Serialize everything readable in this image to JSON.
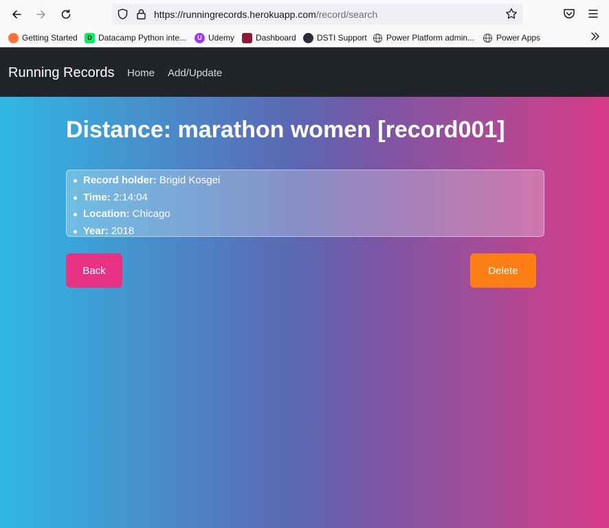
{
  "browser": {
    "url_host": "https://runningrecords.herokuapp.com",
    "url_path": "/record/search",
    "bookmarks": [
      {
        "label": "Getting Started",
        "icon": "firefox-icon",
        "color": "#ff7139"
      },
      {
        "label": "Datacamp Python inte...",
        "icon": "datacamp-icon",
        "color": "#03ef62"
      },
      {
        "label": "Udemy",
        "icon": "udemy-icon",
        "color": "#a435f0"
      },
      {
        "label": "Dashboard",
        "icon": "dashboard-icon",
        "color": "#8b1a3a"
      },
      {
        "label": "DSTI Support",
        "icon": "dsti-icon",
        "color": "#2b2b3a"
      },
      {
        "label": "Power Platform admin...",
        "icon": "globe-icon",
        "color": "#444444"
      },
      {
        "label": "Power Apps",
        "icon": "globe-icon",
        "color": "#444444"
      }
    ]
  },
  "navbar": {
    "brand": "Running Records",
    "links": [
      "Home",
      "Add/Update"
    ]
  },
  "page": {
    "title": "Distance: marathon women [record001]",
    "details": [
      {
        "label": "Record holder:",
        "value": "Brigid Kosgei"
      },
      {
        "label": "Time:",
        "value": "2:14:04"
      },
      {
        "label": "Location:",
        "value": "Chicago"
      },
      {
        "label": "Year:",
        "value": "2018"
      }
    ],
    "back_label": "Back",
    "delete_label": "Delete"
  },
  "colors": {
    "back_button": "#e83283",
    "delete_button": "#fd7e14",
    "navbar": "#212529"
  }
}
